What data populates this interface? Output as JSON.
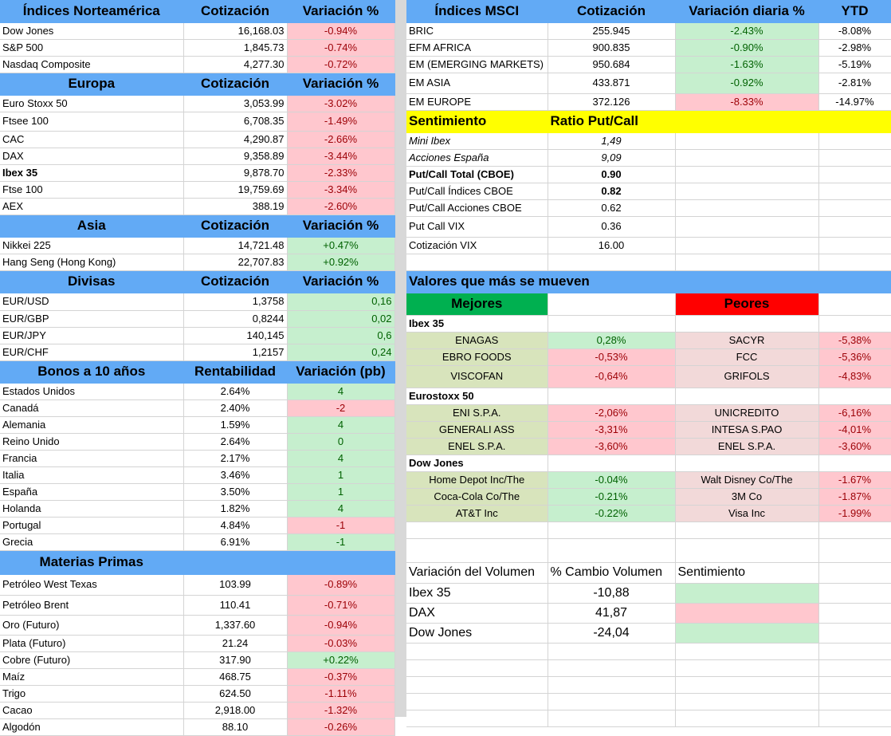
{
  "left": {
    "nam": {
      "h": [
        "Índices Norteamérica",
        "Cotización",
        "Variación %"
      ],
      "rows": [
        [
          "Dow Jones",
          "16,168.03",
          "-0.94%"
        ],
        [
          "S&P 500",
          "1,845.73",
          "-0.74%"
        ],
        [
          "Nasdaq Composite",
          "4,277.30",
          "-0.72%"
        ]
      ]
    },
    "eur": {
      "h": [
        "Europa",
        "Cotización",
        "Variación %"
      ],
      "rows": [
        [
          "Euro Stoxx 50",
          "3,053.99",
          "-3.02%"
        ],
        [
          "Ftsee 100",
          "6,708.35",
          "-1.49%"
        ],
        [
          "CAC",
          "4,290.87",
          "-2.66%"
        ],
        [
          "DAX",
          "9,358.89",
          "-3.44%"
        ],
        [
          "Ibex 35",
          "9,878.70",
          "-2.33%"
        ],
        [
          "Ftse 100",
          "19,759.69",
          "-3.34%"
        ],
        [
          "AEX",
          "388.19",
          "-2.60%"
        ]
      ]
    },
    "asia": {
      "h": [
        "Asia",
        "Cotización",
        "Variación %"
      ],
      "rows": [
        [
          "Nikkei 225",
          "14,721.48",
          "+0.47%"
        ],
        [
          "Hang Seng (Hong Kong)",
          "22,707.83",
          "+0.92%"
        ]
      ]
    },
    "div": {
      "h": [
        "Divisas",
        "Cotización",
        "Variación %"
      ],
      "rows": [
        [
          "EUR/USD",
          "1,3758",
          "0,16"
        ],
        [
          "EUR/GBP",
          "0,8244",
          "0,02"
        ],
        [
          "EUR/JPY",
          "140,145",
          "0,6"
        ],
        [
          "EUR/CHF",
          "1,2157",
          "0,24"
        ]
      ]
    },
    "bon": {
      "h": [
        "Bonos a 10 años",
        "Rentabilidad",
        "Variación (pb)"
      ],
      "rows": [
        [
          "Estados Unidos",
          "2.64%",
          "4"
        ],
        [
          "Canadá",
          "2.40%",
          "-2"
        ],
        [
          "Alemania",
          "1.59%",
          "4"
        ],
        [
          "Reino Unido",
          "2.64%",
          "0"
        ],
        [
          "Francia",
          "2.17%",
          "4"
        ],
        [
          "Italia",
          "3.46%",
          "1"
        ],
        [
          "España",
          "3.50%",
          "1"
        ],
        [
          "Holanda",
          "1.82%",
          "4"
        ],
        [
          "Portugal",
          "4.84%",
          "-1"
        ],
        [
          "Grecia",
          "6.91%",
          "-1"
        ]
      ]
    },
    "mat": {
      "h": [
        "Materias Primas",
        "",
        ""
      ],
      "rows": [
        [
          "Petróleo West Texas",
          "103.99",
          "-0.89%"
        ],
        [
          "Petróleo Brent",
          "110.41",
          "-0.71%"
        ],
        [
          "Oro (Futuro)",
          "1,337.60",
          "-0.94%"
        ],
        [
          "Plata (Futuro)",
          "21.24",
          "-0.03%"
        ],
        [
          "Cobre (Futuro)",
          "317.90",
          "+0.22%"
        ],
        [
          "Maíz",
          "468.75",
          "-0.37%"
        ],
        [
          "Trigo",
          "624.50",
          "-1.11%"
        ],
        [
          "Cacao",
          "2,918.00",
          "-1.32%"
        ],
        [
          "Algodón",
          "88.10",
          "-0.26%"
        ]
      ]
    }
  },
  "msci": {
    "h": [
      "Índices MSCI",
      "Cotización",
      "Variación diaria %",
      "YTD"
    ],
    "rows": [
      [
        "BRIC",
        "255.945",
        "-2.43%",
        "-8.08%"
      ],
      [
        "EFM AFRICA",
        "900.835",
        "-0.90%",
        "-2.98%"
      ],
      [
        "EM (EMERGING MARKETS)",
        "950.684",
        "-1.63%",
        "-5.19%"
      ],
      [
        "EM ASIA",
        "433.871",
        "-0.92%",
        "-2.81%"
      ],
      [
        "EM EUROPE",
        "372.126",
        "-8.33%",
        "-14.97%"
      ]
    ]
  },
  "sent": {
    "h": [
      "Sentimiento",
      "Ratio Put/Call"
    ],
    "rows": [
      [
        "Mini Ibex",
        "1,49"
      ],
      [
        "Acciones España",
        "9,09"
      ],
      [
        "Put/Call Total (CBOE)",
        "0.90"
      ],
      [
        "Put/Call Índices CBOE",
        "0.82"
      ],
      [
        "Put/Call Acciones CBOE",
        "0.62"
      ],
      [
        "Put Call VIX",
        "0.36"
      ],
      [
        "Cotización VIX",
        "16.00"
      ]
    ]
  },
  "movers": {
    "title": "Valores que más se mueven",
    "best": "Mejores",
    "worst": "Peores",
    "groups": [
      {
        "name": "Ibex 35",
        "rows": [
          [
            "ENAGAS",
            "0,28%",
            "SACYR",
            "-5,38%"
          ],
          [
            "EBRO FOODS",
            "-0,53%",
            "FCC",
            "-5,36%"
          ],
          [
            "VISCOFAN",
            "-0,64%",
            "GRIFOLS",
            "-4,83%"
          ]
        ]
      },
      {
        "name": "Eurostoxx 50",
        "rows": [
          [
            "ENI S.P.A.",
            "-2,06%",
            "UNICREDITO",
            "-6,16%"
          ],
          [
            "GENERALI ASS",
            "-3,31%",
            "INTESA S.PAO",
            "-4,01%"
          ],
          [
            "ENEL S.P.A.",
            "-3,60%",
            "ENEL S.P.A.",
            "-3,60%"
          ]
        ]
      },
      {
        "name": "Dow Jones",
        "rows": [
          [
            "Home Depot Inc/The",
            "-0.04%",
            "Walt Disney Co/The",
            "-1.67%"
          ],
          [
            "Coca-Cola Co/The",
            "-0.21%",
            "3M Co",
            "-1.87%"
          ],
          [
            "AT&T Inc",
            "-0.22%",
            "Visa Inc",
            "-1.99%"
          ]
        ]
      }
    ]
  },
  "vol": {
    "h": [
      "Variación del Volumen",
      "% Cambio Volumen",
      "Sentimiento"
    ],
    "rows": [
      [
        "Ibex 35",
        "-10,88"
      ],
      [
        "DAX",
        "41,87"
      ],
      [
        "Dow Jones",
        "-24,04"
      ]
    ]
  },
  "colors": {
    "header": "#62aaf5",
    "neg": "#ffc7ce",
    "pos": "#c6efce",
    "sentiment": "#ffff00",
    "best": "#00b050",
    "worst": "#ff0000"
  }
}
